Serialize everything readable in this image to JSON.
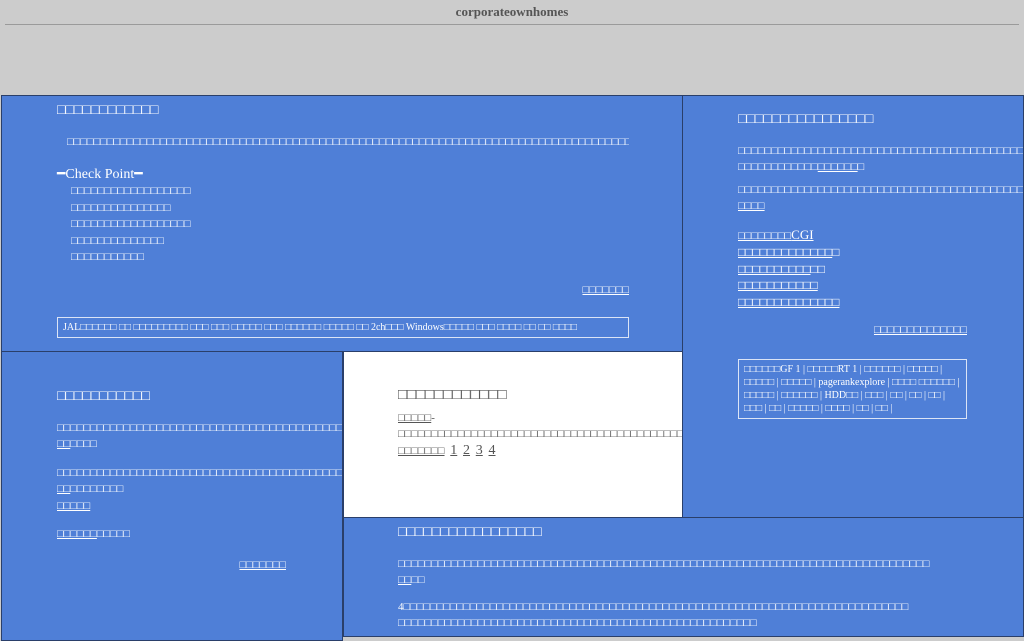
{
  "site": {
    "title": "corporateownhomes"
  },
  "panel_main": {
    "heading": "□□□□□□□□□□□□",
    "body": "□□□□□□□□□□□□□□□□□□□□□□□□□□□□□□□□□□□□□□□□□□□□□□□□□□□□□□□□□□□□□□□□□□□□□□□□□□□□□□□□□□□□□□□□□□□□□□□□□□□□□□□□□□□□□□□□□□□□□□□□□□□□□□□□□□",
    "checkpoint_title": "━Check Point━",
    "checklist": [
      "□□□□□□□□□□□□□□□□□□",
      "□□□□□□□□□□□□□□□",
      "□□□□□□□□□□□□□□□□□□",
      "□□□□□□□□□□□□□□",
      "□□□□□□□□□□□"
    ],
    "more_link": "□□□□□□□",
    "tag_line": "JAL□□□□□□ □□ □□□□□□□□□ □□□ □□□ □□□□□ □□□ □□□□□□ □□□□□ □□ 2ch□□□ Windows□□□□□ □□□ □□□□ □□ □□ □□□□"
  },
  "panel_right": {
    "heading": "□□□□□□□□□□□□□□□□",
    "para1": "□□□□□□□□□□□□□□□□□□□□□□□□□□□□□□□□□□□□□□□□□□□□□□□□□□□□□□□□□□□□□□□□□□□□□□□□□□□□□□□□□□□□□□□□□□□□□□□□□□□□□□□□□□□□",
    "para1_lead": "□□□□□□□□□□□□",
    "para1_link": "□□□□□□",
    "para1_tail": "□",
    "para2": "□□□□□□□□□□□□□□□□□□□□□□□□□□□□□□□□□□□□□□□□□□□□□□□□□□□□□□□",
    "para2_link": "□□□□",
    "cgi_lead": "□□□□□□□□",
    "cgi_text": "CGI",
    "links": [
      {
        "link": "□□□□□□□□□□□□□",
        "tail": "□"
      },
      {
        "link": "□□□□□□□□□□",
        "tail": "□□"
      },
      {
        "link": "□□□□□□□□□□□",
        "tail": ""
      },
      {
        "link": "□□□□□□□□□□□□□□",
        "tail": ""
      }
    ],
    "more_link": "□□□□□□□□□□□□□□",
    "tags": "□□□□□□GF 1 | □□□□□RT 1 | □□□□□□ | □□□□□ | □□□□□ | □□□□□ | pagerankexplore | □□□□ □□□□□□ | □□□□□ | □□□□□□ | HDD□□ | □□□ | □□ | □□ | □□ | □□□ | □□ | □□□□□ | □□□□ | □□ | □□ |"
  },
  "panel_left": {
    "heading": "□□□□□□□□□□□",
    "para1": "□□□□□□□□□□□□□□□□□□□□□□□□□□□□□□□□□□□□□□□□□□□□□□□□□□□□□□□□□□□",
    "para1_link": "□□",
    "para1_tail": "□□□□",
    "para2": "□□□□□□□□□□□□□□□□□□□□□□□□□□□□□□□□□□□□□□□□□□□□□□□□□□□□□□□□□□□□□□□□□□□□□□□□□□□□□□□□□□□□□□□□□□□□□□",
    "para2_link": "□□",
    "para2_tail": "□□□□□□□□",
    "link_a": "□□□□□",
    "footer_link": "□□□□□□",
    "footer_tail": "□□□□□",
    "more_link": "□□□□□□□"
  },
  "panel_center": {
    "heading": "□□□□□□□□□□□□",
    "body_link": "□□□□□",
    "body": "-□□□□□□□□□□□□□□□□□□□□□□□□□□□□□□□□□□□□□□□□□□□□□□□□□□□□□□□□□□□□□□□□□□□□□□□□□□□□□□□□□□□□□□□□□□□□□□",
    "pages_label": "□□□□□□□",
    "pages": [
      "1",
      "2",
      "3",
      "4"
    ]
  },
  "panel_bottom": {
    "heading": "□□□□□□□□□□□□□□□□□",
    "para1": "□□□□□□□□□□□□□□□□□□□□□□□□□□□□□□□□□□□□□□□□□□□□□□□□□□□□□□□□□□□□□□□□□□□□□□□□□□□□□□□□",
    "para1_link": "□□",
    "para1_tail": "□□",
    "para2": "4□□□□□□□□□□□□□□□□□□□□□□□□□□□□□□□□□□□□□□□□□□□□□□□□□□□□□□□□□□□□□□□□□□□□□□□□□□□□ □□□□□□□□□□□□□□□□□□□□□□□□□□□□□□□□□□□□□□□□□□□□□□□□□□□□□□"
  }
}
